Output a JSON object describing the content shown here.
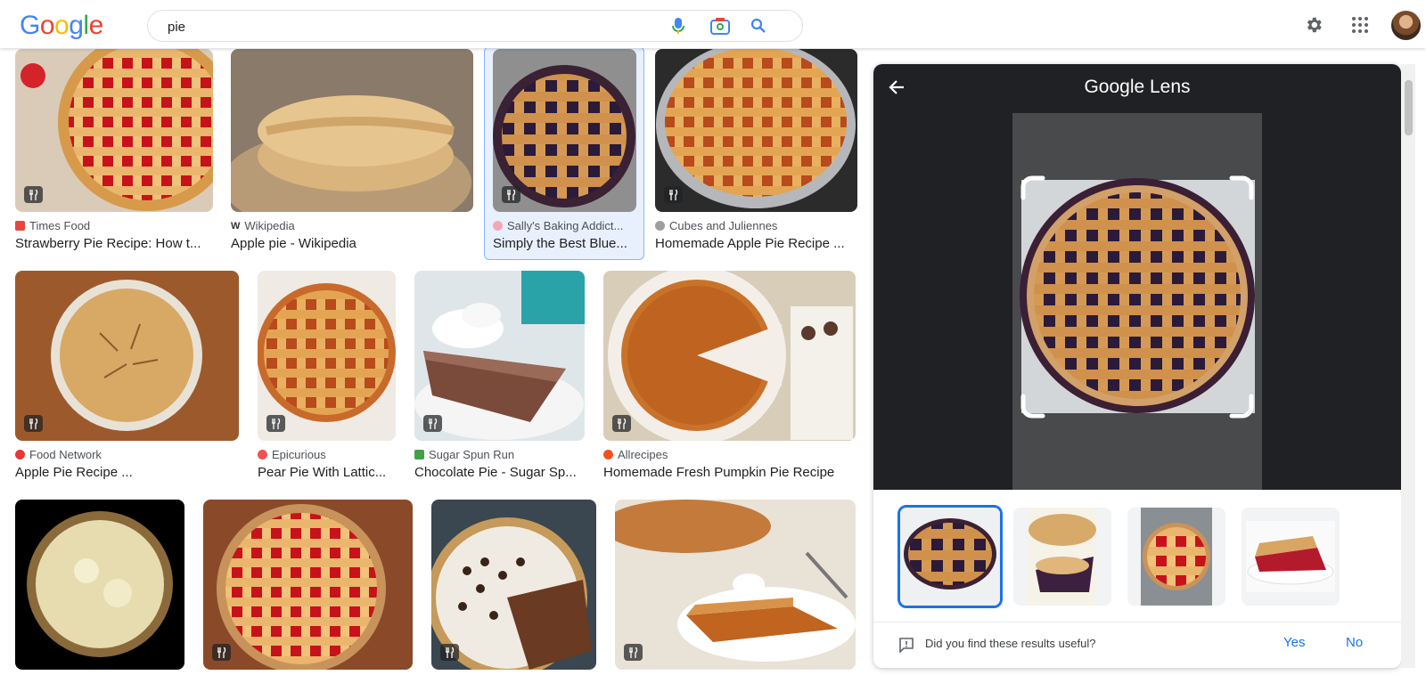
{
  "header": {
    "logo": "Google",
    "search_value": "pie",
    "icons": [
      "mic-icon",
      "camera-icon",
      "search-icon",
      "gear-icon",
      "apps-icon",
      "avatar"
    ]
  },
  "results": {
    "row1": [
      {
        "source": "Times Food",
        "title": "Strawberry Pie Recipe: How t...",
        "fav_color": "#e8453c"
      },
      {
        "source": "Wikipedia",
        "title": "Apple pie - Wikipedia",
        "fav_color": "#555555"
      },
      {
        "source": "Sally's Baking Addict...",
        "title": "Simply the Best Blue...",
        "fav_color": "#f4a7b9"
      },
      {
        "source": "Cubes and Juliennes",
        "title": "Homemade Apple Pie Recipe ...",
        "fav_color": "#9e9e9e"
      }
    ],
    "row2": [
      {
        "source": "Food Network",
        "title": "Apple Pie Recipe ...",
        "fav_color": "#e53935"
      },
      {
        "source": "Epicurious",
        "title": "Pear Pie With Lattic...",
        "fav_color": "#ef5350"
      },
      {
        "source": "Sugar Spun Run",
        "title": "Chocolate Pie - Sugar Sp...",
        "fav_color": "#43a047"
      },
      {
        "source": "Allrecipes",
        "title": "Homemade Fresh Pumpkin Pie Recipe",
        "fav_color": "#f4511e"
      }
    ]
  },
  "lens": {
    "title": "Google Lens",
    "feedback_question": "Did you find these results useful?",
    "yes_label": "Yes",
    "no_label": "No"
  },
  "colors": {
    "accent": "#1a73e8",
    "selected_bg": "#e8f0fe",
    "lens_bg": "#202124"
  }
}
